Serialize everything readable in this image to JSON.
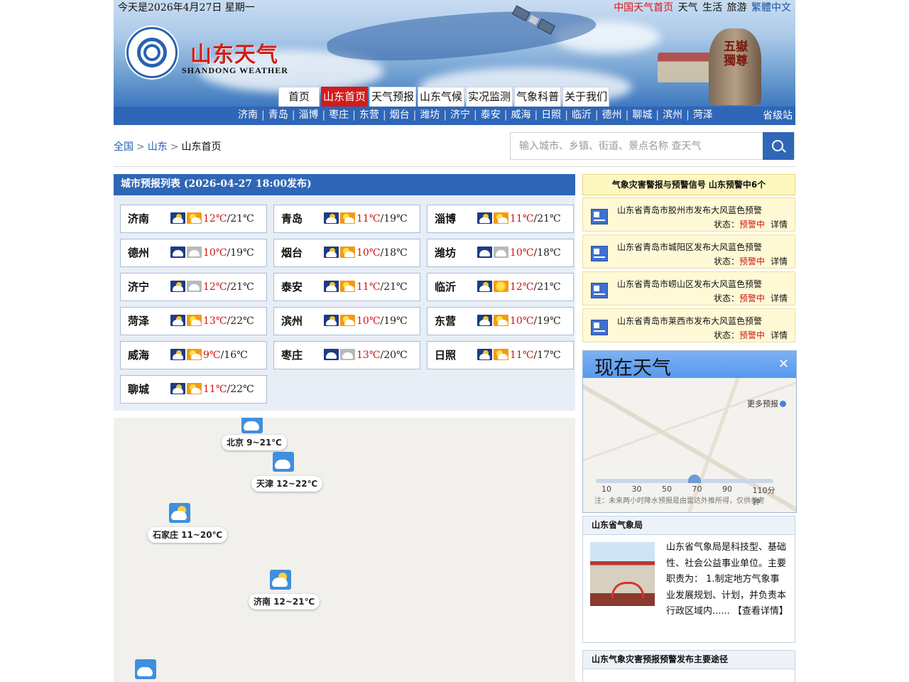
{
  "header": {
    "date_text": "今天是2026年4月27日   星期一",
    "top_links": [
      {
        "label": "中国天气首页",
        "color": "red"
      },
      {
        "label": "天气",
        "color": "black"
      },
      {
        "label": "生活",
        "color": "black"
      },
      {
        "label": "旅游",
        "color": "black"
      },
      {
        "label": "繁體中文",
        "color": "blue"
      }
    ],
    "logo_title": "山东天气",
    "logo_subtitle": "SHANDONG  WEATHER",
    "banner_rock_text": "五嶽獨尊",
    "nav": [
      {
        "label": "首页",
        "active": false
      },
      {
        "label": "山东首页",
        "active": true
      },
      {
        "label": "天气预报",
        "active": false
      },
      {
        "label": "山东气候",
        "active": false
      },
      {
        "label": "实况监测",
        "active": false
      },
      {
        "label": "气象科普",
        "active": false
      },
      {
        "label": "关于我们",
        "active": false
      }
    ]
  },
  "citybar": {
    "cities": [
      "济南",
      "青岛",
      "淄博",
      "枣庄",
      "东营",
      "烟台",
      "潍坊",
      "济宁",
      "泰安",
      "威海",
      "日照",
      "临沂",
      "德州",
      "聊城",
      "滨州",
      "菏泽"
    ],
    "separator": "|",
    "province_link": "省级站"
  },
  "breadcrumb": {
    "items": [
      "全国",
      "山东",
      "山东首页"
    ],
    "separator": ">"
  },
  "search": {
    "placeholder": "输入城市、乡镇、街道、景点名称 查天气"
  },
  "forecast": {
    "title": "城市预报列表 (2026-04-27 18:00发布)",
    "cities": [
      {
        "name": "济南",
        "icon1": "night-partly-cloudy",
        "icon2": "day-partly-cloudy",
        "low": "12℃",
        "high": "/21℃"
      },
      {
        "name": "青岛",
        "icon1": "night-partly-cloudy",
        "icon2": "day-partly-cloudy",
        "low": "11℃",
        "high": "/19℃"
      },
      {
        "name": "淄博",
        "icon1": "night-partly-cloudy",
        "icon2": "day-partly-cloudy",
        "low": "11℃",
        "high": "/21℃"
      },
      {
        "name": "德州",
        "icon1": "night-cloudy",
        "icon2": "cloudy",
        "low": "10℃",
        "high": "/19℃"
      },
      {
        "name": "烟台",
        "icon1": "night-partly-cloudy",
        "icon2": "day-partly-cloudy",
        "low": "10℃",
        "high": "/18℃"
      },
      {
        "name": "潍坊",
        "icon1": "night-cloudy",
        "icon2": "cloudy",
        "low": "10℃",
        "high": "/18℃"
      },
      {
        "name": "济宁",
        "icon1": "night-partly-cloudy",
        "icon2": "cloudy",
        "low": "12℃",
        "high": "/21℃"
      },
      {
        "name": "泰安",
        "icon1": "night-partly-cloudy",
        "icon2": "day-partly-cloudy",
        "low": "11℃",
        "high": "/21℃"
      },
      {
        "name": "临沂",
        "icon1": "night-partly-cloudy",
        "icon2": "sunny",
        "low": "12℃",
        "high": "/21℃"
      },
      {
        "name": "菏泽",
        "icon1": "night-partly-cloudy",
        "icon2": "day-partly-cloudy",
        "low": "13℃",
        "high": "/22℃"
      },
      {
        "name": "滨州",
        "icon1": "night-partly-cloudy",
        "icon2": "day-partly-cloudy",
        "low": "10℃",
        "high": "/19℃"
      },
      {
        "name": "东营",
        "icon1": "night-partly-cloudy",
        "icon2": "day-partly-cloudy",
        "low": "10℃",
        "high": "/19℃"
      },
      {
        "name": "威海",
        "icon1": "night-partly-cloudy",
        "icon2": "day-partly-cloudy",
        "low": "9℃",
        "high": "/16℃"
      },
      {
        "name": "枣庄",
        "icon1": "night-cloudy",
        "icon2": "cloudy",
        "low": "13℃",
        "high": "/20℃"
      },
      {
        "name": "日照",
        "icon1": "night-partly-cloudy",
        "icon2": "day-partly-cloudy",
        "low": "11℃",
        "high": "/17℃"
      },
      {
        "name": "聊城",
        "icon1": "night-partly-cloudy",
        "icon2": "day-partly-cloudy",
        "low": "11℃",
        "high": "/22℃"
      }
    ]
  },
  "map": {
    "markers": [
      {
        "label": "北京 9~21℃",
        "icon": "cloud"
      },
      {
        "label": "天津 12~22℃",
        "icon": "cloud"
      },
      {
        "label": "石家庄 11~20℃",
        "icon": "partly-cloudy"
      },
      {
        "label": "济南 12~21℃",
        "icon": "partly-cloudy"
      },
      {
        "label": "",
        "icon": "cloud"
      }
    ]
  },
  "warnings": {
    "header": "气象灾害警报与预警信号   山东预警中6个",
    "items": [
      {
        "text": "山东省青岛市胶州市发布大风蓝色预警",
        "state_label": "状态：",
        "state": "预警中",
        "detail": "详情"
      },
      {
        "text": "山东省青岛市城阳区发布大风蓝色预警",
        "state_label": "状态：",
        "state": "预警中",
        "detail": "详情"
      },
      {
        "text": "山东省青岛市崂山区发布大风蓝色预警",
        "state_label": "状态：",
        "state": "预警中",
        "detail": "详情"
      },
      {
        "text": "山东省青岛市莱西市发布大风蓝色预警",
        "state_label": "状态：",
        "state": "预警中",
        "detail": "详情"
      }
    ]
  },
  "now_weather": {
    "title": "现在天气",
    "more": "更多预报",
    "ticks": [
      "10",
      "30",
      "50",
      "70",
      "90",
      "110分钟"
    ],
    "note": "注：未来两小时降水预报是由雷达外推所得，仅供参考"
  },
  "bureau": {
    "title": "山东省气象局",
    "text": "山东省气象局是科技型、基础性、社会公益事业单位。主要职责为： 1.制定地方气象事业发展规划、计划，并负责本行政区域内...... 【查看详情】"
  },
  "release": {
    "title": "山东气象灾害预报预警发布主要途径"
  },
  "colors": {
    "primary_blue": "#2f66b7",
    "nav_active_red": "#d01c1c",
    "temp_red": "#d11414",
    "warning_bg": "#fff9d6"
  }
}
